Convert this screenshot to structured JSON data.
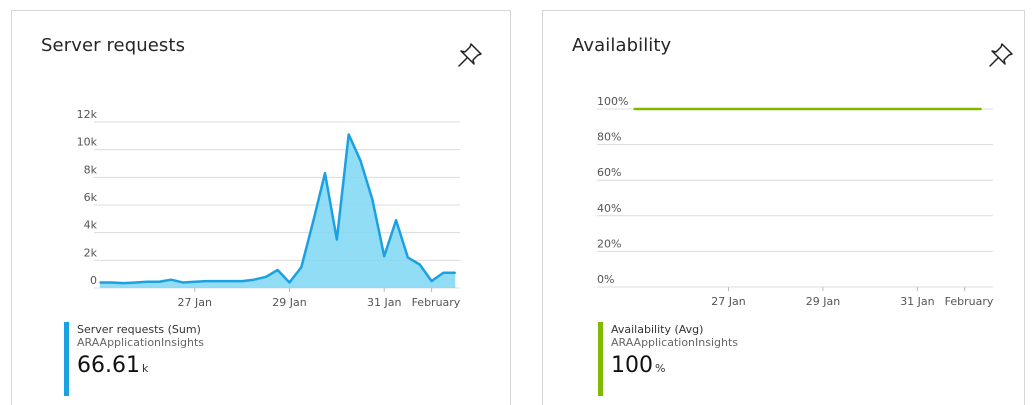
{
  "tiles": [
    {
      "title": "Server requests",
      "pin_icon": "pin-icon",
      "accent": "#1ba1e2",
      "fill": "#7fd7f5",
      "legend": {
        "metric": "Server requests (Sum)",
        "resource": "ARAApplicationInsights",
        "value": "66.61",
        "unit": "k"
      }
    },
    {
      "title": "Availability",
      "pin_icon": "pin-icon",
      "accent": "#7fba00",
      "legend": {
        "metric": "Availability (Avg)",
        "resource": "ARAApplicationInsights",
        "value": "100",
        "unit": "%"
      }
    }
  ],
  "chart_data": [
    {
      "type": "area",
      "title": "",
      "y_ticks": [
        "0",
        "2k",
        "4k",
        "6k",
        "8k",
        "10k",
        "12k"
      ],
      "ylim": [
        0,
        12000
      ],
      "x_ticks": [
        "27 Jan",
        "29 Jan",
        "31 Jan",
        "February"
      ],
      "x_tick_positions": [
        27,
        29,
        31,
        32
      ],
      "xlim": [
        25.0,
        32.6
      ],
      "series": [
        {
          "name": "Server requests (Sum)",
          "x": [
            25.0,
            25.25,
            25.5,
            25.75,
            26.0,
            26.25,
            26.5,
            26.75,
            27.0,
            27.25,
            27.5,
            27.75,
            28.0,
            28.25,
            28.5,
            28.75,
            29.0,
            29.25,
            29.5,
            29.75,
            30.0,
            30.25,
            30.5,
            30.75,
            31.0,
            31.25,
            31.5,
            31.75,
            32.0,
            32.25,
            32.5
          ],
          "values": [
            400,
            400,
            350,
            400,
            450,
            450,
            600,
            400,
            450,
            500,
            500,
            500,
            500,
            600,
            800,
            1300,
            400,
            1500,
            4800,
            8300,
            3500,
            11100,
            9200,
            6400,
            2300,
            4900,
            2200,
            1700,
            500,
            1100,
            1100
          ]
        }
      ],
      "grid": true
    },
    {
      "type": "line",
      "title": "",
      "y_ticks": [
        "0%",
        "20%",
        "40%",
        "60%",
        "80%",
        "100%"
      ],
      "ylim": [
        0,
        100
      ],
      "x_ticks": [
        "27 Jan",
        "29 Jan",
        "31 Jan",
        "February"
      ],
      "x_tick_positions": [
        27,
        29,
        31,
        32
      ],
      "xlim": [
        25.0,
        32.6
      ],
      "series": [
        {
          "name": "Availability (Avg)",
          "x": [
            25.0,
            32.35
          ],
          "values": [
            100,
            100
          ]
        }
      ],
      "grid": true
    }
  ]
}
